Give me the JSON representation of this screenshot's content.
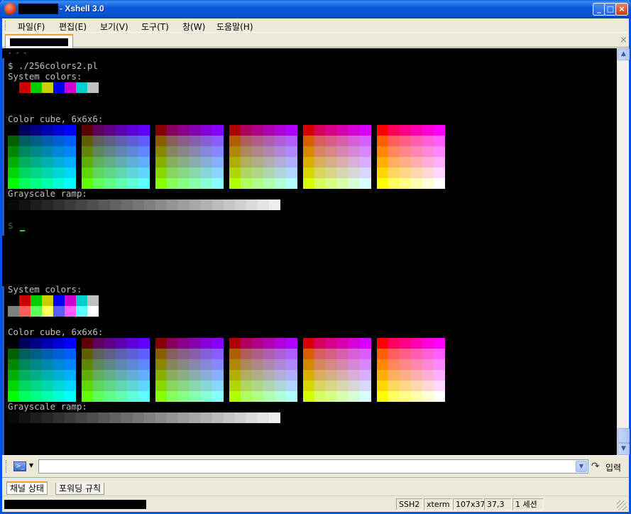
{
  "window": {
    "title": "- Xshell 3.0",
    "controls": {
      "minimize": "_",
      "maximize": "□",
      "close": "×"
    }
  },
  "menu": [
    {
      "label": "파일(F)"
    },
    {
      "label": "편집(E)"
    },
    {
      "label": "보기(V)"
    },
    {
      "label": "도구(T)"
    },
    {
      "label": "창(W)"
    },
    {
      "label": "도움말(H)"
    }
  ],
  "tabbar": {
    "close_glyph": "×"
  },
  "terminal": {
    "lines": {
      "prompt_cmd": "$ ./256colors2.pl",
      "system_colors": "System colors:",
      "color_cube": "Color cube, 6x6x6:",
      "grayscale": "Grayscale ramp:",
      "prompt_end": "$",
      "system_colors_2": "System colors:",
      "color_cube_2": "Color cube, 6x6x6:",
      "grayscale_2": "Grayscale ramp:"
    },
    "system_colors_row1": [
      "#000000",
      "#cd0000",
      "#00cd00",
      "#cdcd00",
      "#0000ee",
      "#cd00cd",
      "#00cdcd",
      "#c0c0c0"
    ],
    "system_colors_row2": [
      "#7f7f7f",
      "#ff5c5c",
      "#5cff5c",
      "#ffff5c",
      "#5c5cff",
      "#ff5cff",
      "#5cffff",
      "#ffffff"
    ],
    "cube_levels": [
      0,
      95,
      135,
      175,
      215,
      255
    ],
    "grayscale_levels": [
      8,
      18,
      28,
      38,
      48,
      58,
      68,
      78,
      88,
      98,
      108,
      118,
      128,
      138,
      148,
      158,
      168,
      178,
      188,
      198,
      208,
      218,
      228,
      238
    ]
  },
  "compose": {
    "input_value": "",
    "send_label": "입력",
    "icon": "terminal-icon"
  },
  "bottom_tabs": [
    {
      "label": "채널 상태"
    },
    {
      "label": "포워딩 규칙"
    }
  ],
  "status": {
    "protocol": "SSH2",
    "term_type": "xterm",
    "size": "107x37",
    "cursor_pos": "37,3",
    "sessions": "1 세션"
  }
}
